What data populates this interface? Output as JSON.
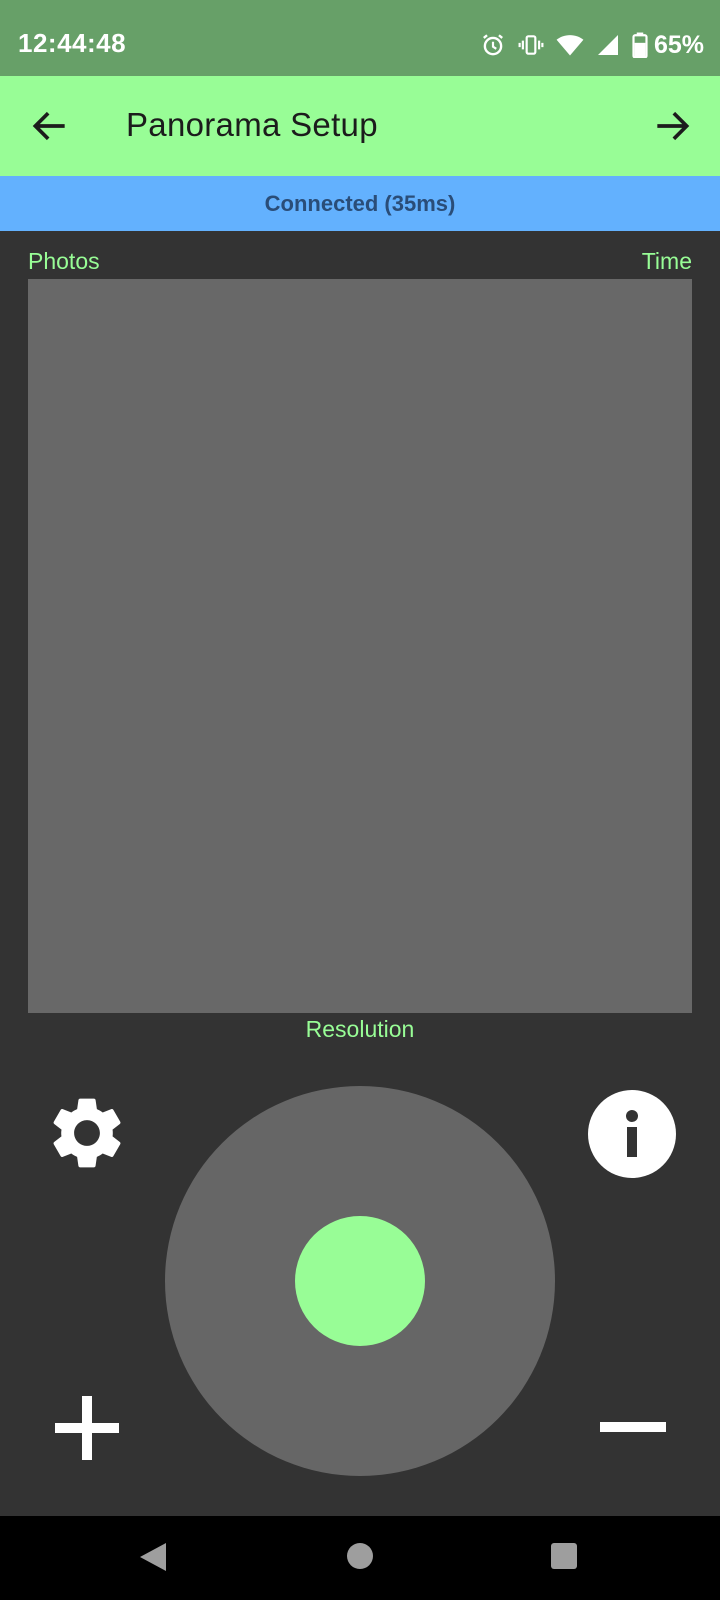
{
  "status_bar": {
    "time": "12:44:48",
    "battery_percent": "65%",
    "icons": [
      "alarm-icon",
      "vibrate-icon",
      "wifi-icon",
      "cell-signal-icon",
      "battery-icon"
    ]
  },
  "app_bar": {
    "title": "Panorama Setup",
    "back_icon": "arrow-left-icon",
    "forward_icon": "arrow-right-icon"
  },
  "connection": {
    "status": "Connected (35ms)"
  },
  "preview": {
    "label_left": "Photos",
    "label_right": "Time",
    "label_bottom": "Resolution"
  },
  "controls": {
    "settings_icon": "gear-icon",
    "info_icon": "info-icon",
    "zoom_in_icon": "plus-icon",
    "zoom_out_icon": "minus-icon",
    "joystick": "joystick"
  },
  "system_nav": {
    "back": "nav-back-icon",
    "home": "nav-home-icon",
    "recents": "nav-recents-icon"
  },
  "colors": {
    "status_bar": "#67a068",
    "app_bar": "#98fd96",
    "banner": "#63b1fe",
    "background": "#333333",
    "panel": "#686868",
    "accent_green": "#98fd96"
  }
}
